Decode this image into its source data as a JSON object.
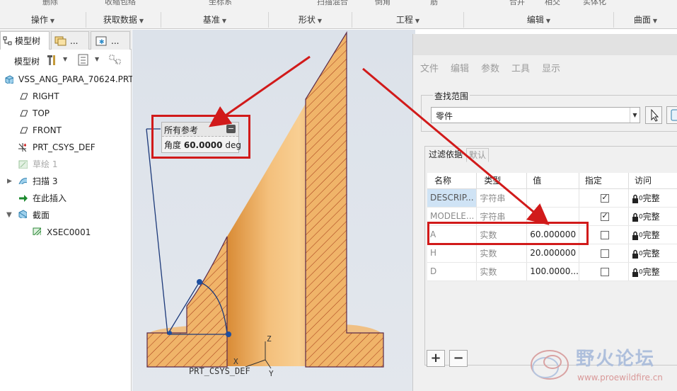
{
  "ribbon": {
    "top_labels": [
      "删除",
      "收缩包络",
      "坐标系",
      "扫描混合",
      "倒角",
      "筋",
      "合并",
      "相交",
      "实体化"
    ],
    "groups": [
      "操作",
      "获取数据",
      "基准",
      "形状",
      "工程",
      "编辑",
      "曲面"
    ]
  },
  "left_panel": {
    "tabs": [
      "模型树",
      "...",
      "..."
    ],
    "toolbar_label": "模型树",
    "tree": [
      {
        "label": "VSS_ANG_PARA_70624.PRT",
        "icon": "part-icon"
      },
      {
        "label": "RIGHT",
        "icon": "datum-plane-icon"
      },
      {
        "label": "TOP",
        "icon": "datum-plane-icon"
      },
      {
        "label": "FRONT",
        "icon": "datum-plane-icon"
      },
      {
        "label": "PRT_CSYS_DEF",
        "icon": "csys-icon"
      },
      {
        "label": "草绘 1",
        "icon": "sketch-icon"
      },
      {
        "label": "扫描 3",
        "icon": "sweep-icon"
      },
      {
        "label": "在此插入",
        "icon": "insert-arrow-icon"
      },
      {
        "label": "截面",
        "icon": "section-icon"
      },
      {
        "label": "XSEC0001",
        "icon": "xsec-icon"
      }
    ]
  },
  "viewport": {
    "callout_title": "所有参考",
    "callout_label": "角度",
    "callout_value": "60.0000",
    "callout_unit": "deg",
    "csys_label": "PRT_CSYS_DEF",
    "axis_z": "Z",
    "axis_x": "X",
    "axis_y": "Y"
  },
  "param_panel": {
    "menu": [
      "文件",
      "编辑",
      "参数",
      "工具",
      "显示"
    ],
    "scope_legend": "查找范围",
    "scope_value": "零件",
    "filter_tabs": [
      "过滤依据",
      "默认"
    ],
    "columns": [
      "名称",
      "类型",
      "值",
      "指定",
      "访问"
    ],
    "rows": [
      {
        "name": "DESCRIP...",
        "type": "字符串",
        "value": "",
        "designated": true,
        "access": "完整"
      },
      {
        "name": "MODELE...",
        "type": "字符串",
        "value": "",
        "designated": true,
        "access": "完整"
      },
      {
        "name": "A",
        "type": "实数",
        "value": "60.000000",
        "designated": false,
        "access": "完整"
      },
      {
        "name": "H",
        "type": "实数",
        "value": "20.000000",
        "designated": false,
        "access": "完整"
      },
      {
        "name": "D",
        "type": "实数",
        "value": "100.0000...",
        "designated": false,
        "access": "完整"
      }
    ],
    "add_label": "+",
    "remove_label": "−"
  },
  "watermark": {
    "title": "野火论坛",
    "url": "www.proewildfire.cn"
  },
  "colors": {
    "highlight_red": "#d11a1a",
    "part_fill": "#e9a85a",
    "hatch": "#b0401a",
    "selection_blue": "#cfe3f5"
  }
}
